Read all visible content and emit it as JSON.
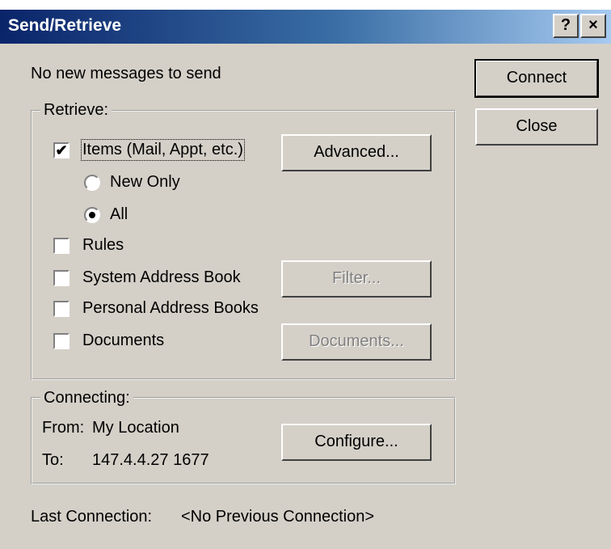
{
  "window": {
    "title": "Send/Retrieve",
    "help_label": "?",
    "close_label": "×"
  },
  "status_message": "No new messages to send",
  "buttons": {
    "connect": "Connect",
    "close": "Close",
    "advanced": "Advanced...",
    "filter": "Filter...",
    "documents": "Documents...",
    "configure": "Configure..."
  },
  "retrieve": {
    "label": "Retrieve:",
    "items": {
      "label": "Items (Mail, Appt, etc.)",
      "checked": true
    },
    "new_only": {
      "label": "New Only",
      "selected": false
    },
    "all": {
      "label": "All",
      "selected": true
    },
    "rules": {
      "label": "Rules",
      "checked": false
    },
    "system_address_book": {
      "label": "System Address Book",
      "checked": false
    },
    "personal_address_books": {
      "label": "Personal Address Books",
      "checked": false
    },
    "documents": {
      "label": "Documents",
      "checked": false
    }
  },
  "connecting": {
    "label": "Connecting:",
    "from_label": "From:",
    "from_value": "My Location",
    "to_label": "To:",
    "to_value": "147.4.4.27 1677"
  },
  "last_connection": {
    "label": "Last Connection:",
    "value": "<No Previous Connection>"
  },
  "icons": {
    "check": "✔"
  }
}
